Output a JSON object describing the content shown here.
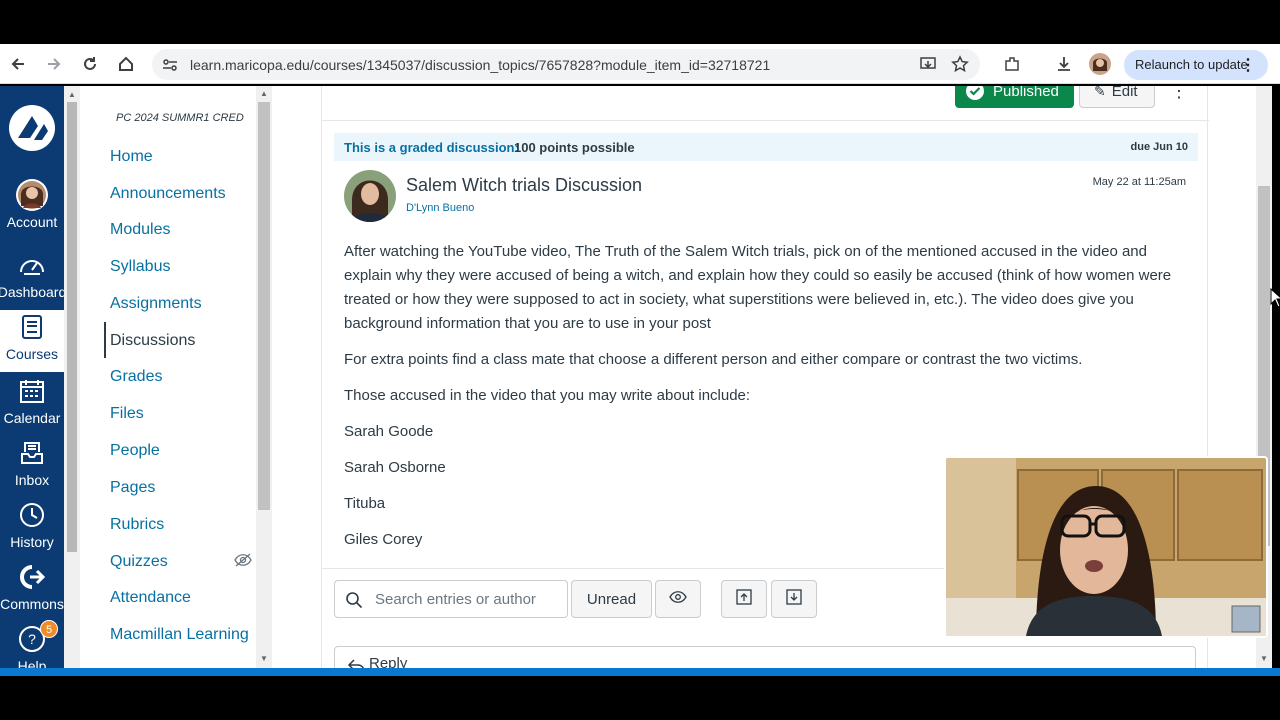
{
  "browser": {
    "url": "learn.maricopa.edu/courses/1345037/discussion_topics/7657828?module_item_id=32718721",
    "relaunch_label": "Relaunch to update"
  },
  "global_nav": [
    {
      "label": "Account",
      "icon": "account-avatar"
    },
    {
      "label": "Dashboard",
      "icon": "dashboard-icon"
    },
    {
      "label": "Courses",
      "icon": "courses-icon",
      "active": true
    },
    {
      "label": "Calendar",
      "icon": "calendar-icon"
    },
    {
      "label": "Inbox",
      "icon": "inbox-icon"
    },
    {
      "label": "History",
      "icon": "history-icon"
    },
    {
      "label": "Commons",
      "icon": "commons-icon"
    },
    {
      "label": "Help",
      "icon": "help-icon",
      "badge": "5"
    }
  ],
  "course_nav": {
    "course_code": "PC 2024 SUMMR1 CRED",
    "items": [
      "Home",
      "Announcements",
      "Modules",
      "Syllabus",
      "Assignments",
      "Discussions",
      "Grades",
      "Files",
      "People",
      "Pages",
      "Rubrics",
      "Quizzes",
      "Attendance",
      "Macmillan Learning"
    ],
    "active": "Discussions"
  },
  "toolbar": {
    "published_label": "Published",
    "edit_label": "Edit"
  },
  "discussion": {
    "graded_label": "This is a graded discussion:",
    "points": "100 points possible",
    "due": "due Jun 10",
    "title": "Salem Witch trials Discussion",
    "author": "D'Lynn Bueno",
    "posted": "May 22 at 11:25am",
    "paragraphs": [
      "After watching the YouTube video, The Truth of the Salem Witch trials, pick on of the mentioned accused in the video and explain why they were accused of being a witch, and explain how they could so easily be accused (think of how women were treated or how they were supposed to act in society, what superstitions were believed in, etc.). The video does give you background information that you are to use in your post",
      "For extra points find a class mate that choose a different person and either compare or contrast the two victims.",
      "Those accused in the video that you may write about include:",
      "Sarah Goode",
      "Sarah Osborne",
      "Tituba",
      "Giles Corey"
    ]
  },
  "controls": {
    "search_placeholder": "Search entries or author",
    "unread_label": "Unread",
    "reply_label": "Reply"
  },
  "colors": {
    "nav_bg": "#0b3b72",
    "link": "#0770a3",
    "published": "#0b874b"
  }
}
